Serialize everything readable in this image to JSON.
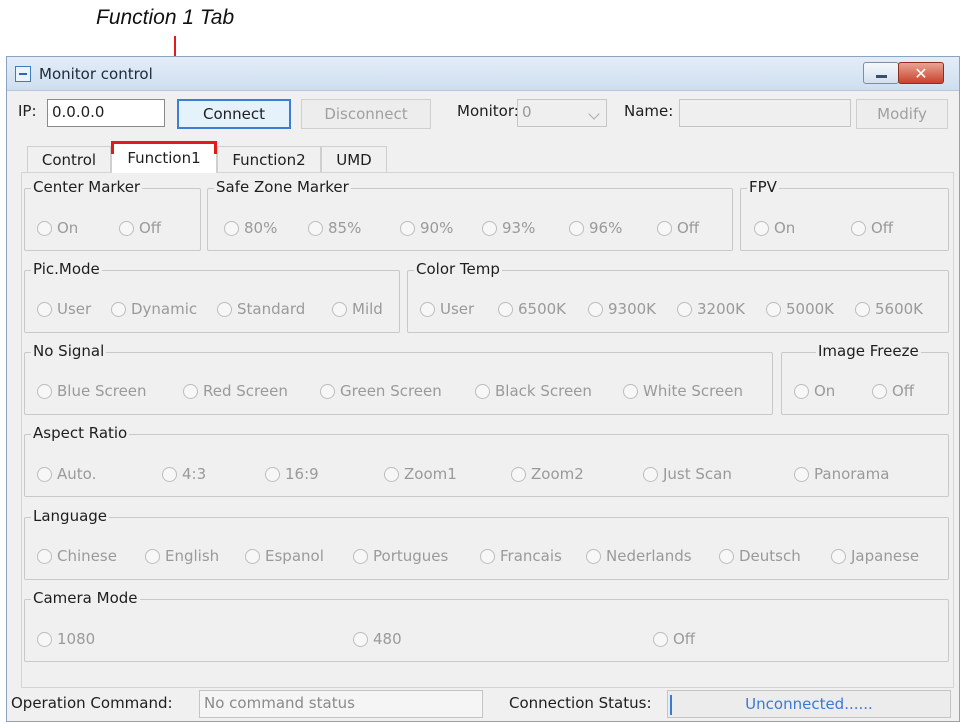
{
  "annotation": {
    "label": "Function 1 Tab"
  },
  "window": {
    "title": "Monitor control"
  },
  "connection": {
    "ip_label": "IP:",
    "ip_value": "0.0.0.0",
    "connect_label": "Connect",
    "disconnect_label": "Disconnect",
    "monitor_label": "Monitor:",
    "monitor_value": "0",
    "name_label": "Name:",
    "name_value": "",
    "modify_label": "Modify"
  },
  "tabs": [
    {
      "label": "Control",
      "active": false
    },
    {
      "label": "Function1",
      "active": true
    },
    {
      "label": "Function2",
      "active": false
    },
    {
      "label": "UMD",
      "active": false
    }
  ],
  "groups": {
    "center_marker": {
      "title": "Center Marker",
      "options": [
        "On",
        "Off"
      ]
    },
    "safe_zone_marker": {
      "title": "Safe Zone Marker",
      "options": [
        "80%",
        "85%",
        "90%",
        "93%",
        "96%",
        "Off"
      ]
    },
    "fpv": {
      "title": "FPV",
      "options": [
        "On",
        "Off"
      ]
    },
    "pic_mode": {
      "title": "Pic.Mode",
      "options": [
        "User",
        "Dynamic",
        "Standard",
        "Mild"
      ]
    },
    "color_temp": {
      "title": "Color Temp",
      "options": [
        "User",
        "6500K",
        "9300K",
        "3200K",
        "5000K",
        "5600K"
      ]
    },
    "no_signal": {
      "title": "No Signal",
      "options": [
        "Blue Screen",
        "Red Screen",
        "Green Screen",
        "Black Screen",
        "White Screen"
      ]
    },
    "image_freeze": {
      "title": "Image Freeze",
      "options": [
        "On",
        "Off"
      ]
    },
    "aspect_ratio": {
      "title": "Aspect Ratio",
      "options": [
        "Auto.",
        "4:3",
        "16:9",
        "Zoom1",
        "Zoom2",
        "Just Scan",
        "Panorama"
      ]
    },
    "language": {
      "title": "Language",
      "options": [
        "Chinese",
        "English",
        "Espanol",
        "Portugues",
        "Francais",
        "Nederlands",
        "Deutsch",
        "Japanese"
      ]
    },
    "camera_mode": {
      "title": "Camera Mode",
      "options": [
        "1080",
        "480",
        "Off"
      ]
    }
  },
  "status": {
    "operation_label": "Operation Command:",
    "operation_value": "No command status",
    "connection_label": "Connection Status:",
    "connection_value": "Unconnected......"
  },
  "colors": {
    "annotation_red": "#e41b1b",
    "status_blue": "#3b79d6",
    "window_bg": "#f0f0f0"
  }
}
